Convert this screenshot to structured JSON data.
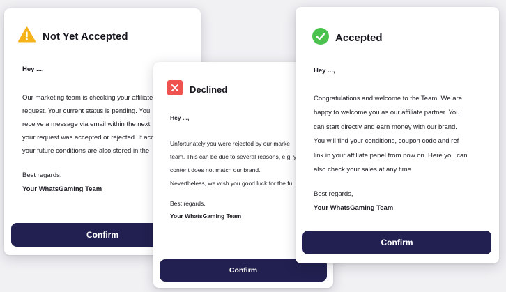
{
  "cards": {
    "not_yet": {
      "title": "Not Yet Accepted",
      "icon": "warning-icon",
      "status_color": "#f5b21b",
      "greeting": "Hey ...,",
      "body_lines": [
        "Our marketing team is checking your affiliate",
        "request. Your current status is pending. You",
        "receive a message via email within the next",
        "your request was accepted or rejected. If acc",
        "your future conditions are also stored in the"
      ],
      "regards": "Best regards,",
      "team": "Your WhatsGaming Team",
      "confirm_label": "Confirm"
    },
    "declined": {
      "title": "Declined",
      "icon": "close-icon",
      "status_color": "#ef5350",
      "greeting": "Hey ...,",
      "body_lines": [
        "Unfortunately you were rejected by our marke",
        "team. This can be due to several reasons, e.g. y",
        "content does not match our brand.",
        "Nevertheless, we wish you good luck for the fu"
      ],
      "regards": "Best regards,",
      "team": "Your WhatsGaming Team",
      "confirm_label": "Confirm"
    },
    "accepted": {
      "title": "Accepted",
      "icon": "check-icon",
      "status_color": "#4cc24e",
      "greeting": "Hey ...,",
      "body_lines": [
        "Congratulations and welcome to the Team. We are",
        "happy to welcome you as our affiliate partner. You",
        "can start directly and earn money with our brand.",
        "You will find your conditions, coupon code and ref",
        "link in your affiliate panel from now on. Here you can",
        "also check your sales at any time."
      ],
      "regards": "Best regards,",
      "team": "Your WhatsGaming Team",
      "confirm_label": "Confirm"
    }
  },
  "theme": {
    "button_bg": "#222050",
    "button_text": "#ffffff"
  }
}
